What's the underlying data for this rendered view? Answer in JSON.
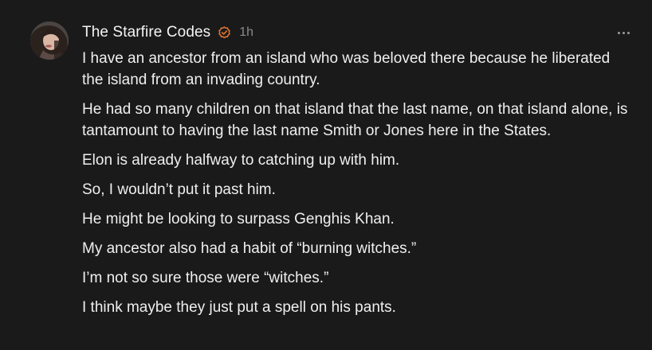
{
  "post": {
    "author": "The Starfire Codes",
    "timestamp": "1h",
    "colors": {
      "background": "#1a1a1b",
      "text": "#efefef",
      "muted": "#8a8a8a",
      "badge": "#e8772e"
    },
    "icons": {
      "avatar": "author-avatar",
      "badge": "verified-badge-icon",
      "more": "more-options-icon"
    },
    "paragraphs": [
      "I have an ancestor from an island who was beloved there because he liberated the island from an invading country.",
      "He had so many children on that island that the last name, on that island alone, is tantamount to having the last name Smith or Jones here in the States.",
      "Elon is already halfway to catching up with him.",
      "So, I wouldn’t put it past him.",
      "He might be looking to surpass Genghis Khan.",
      "My ancestor also had a habit of “burning witches.”",
      "I’m not so sure those were “witches.”",
      "I think maybe they just put a spell on his pants."
    ]
  }
}
